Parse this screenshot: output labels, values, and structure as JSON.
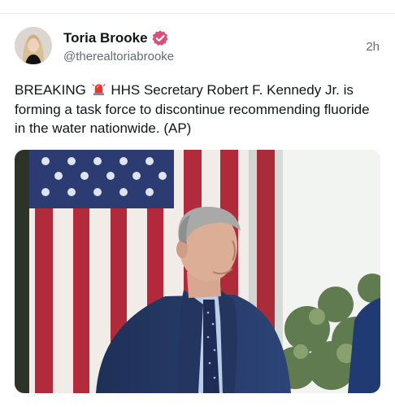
{
  "post": {
    "author_name": "Toria Brooke",
    "handle": "@therealtoriabrooke",
    "timestamp": "2h",
    "text_before_emoji": "BREAKING",
    "emoji": "siren-icon",
    "text_after_emoji": "HHS Secretary Robert F. Kennedy Jr. is forming a task force to discontinue recommending fluoride in the water nationwide. (AP)",
    "verified_color": "#d94f7a"
  }
}
